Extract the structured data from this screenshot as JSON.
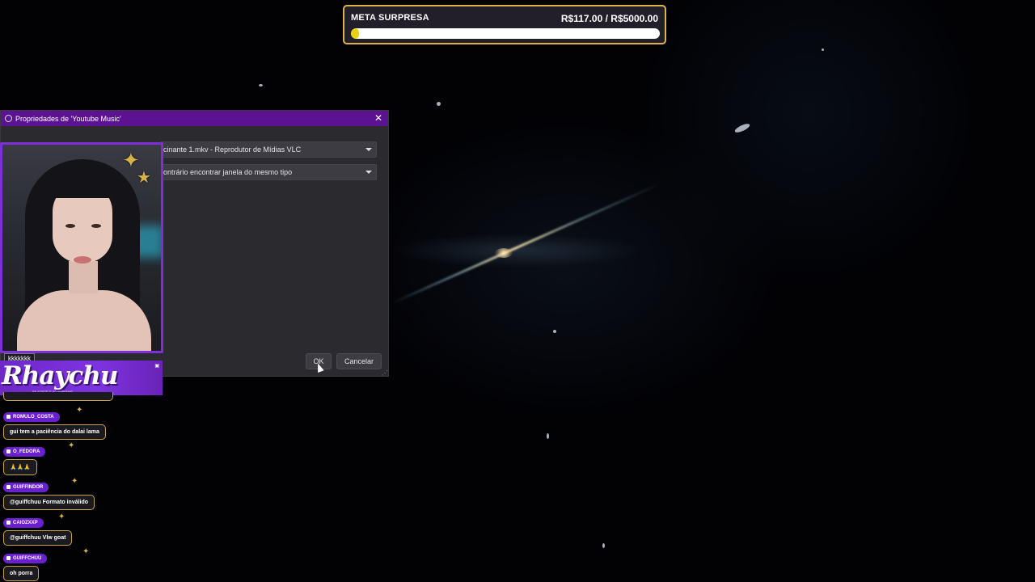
{
  "overlay_goal": {
    "title": "META SURPRESA",
    "amount": "R$117.00 / R$5000.00",
    "progress": 0.0234,
    "bar_color": "#e7d20d",
    "border_color": "#d9b24a"
  },
  "dialog": {
    "title": "Propriedades de 'Youtube Music'",
    "window_select_value": "cinante 1.mkv - Reprodutor de Mídias VLC",
    "match_priority_value": "ontrário encontrar janela do mesmo tipo",
    "ok_label": "OK",
    "cancel_label": "Cancelar",
    "titlebar_color": "#5b1392"
  },
  "stream": {
    "cam_tag": "kkkkkkk",
    "streamer_name": "Rhaychu",
    "banner_subtitle": "SE FORTE E ACOMPANHE"
  },
  "chat": {
    "messages": [
      {
        "user": "ROMULO_COSTA",
        "text": "gui tem a paciência do dalai lama"
      },
      {
        "user": "O_FEDORA",
        "text": "🙏🙏🙏"
      },
      {
        "user": "GUIFFINDOR",
        "text": "@guiffchuu Formato inválido"
      },
      {
        "user": "CAIOZXXP",
        "text": "@guiffchuu Vlw goat"
      },
      {
        "user": "GUIFFCHUU",
        "text": "oh porra"
      }
    ]
  }
}
